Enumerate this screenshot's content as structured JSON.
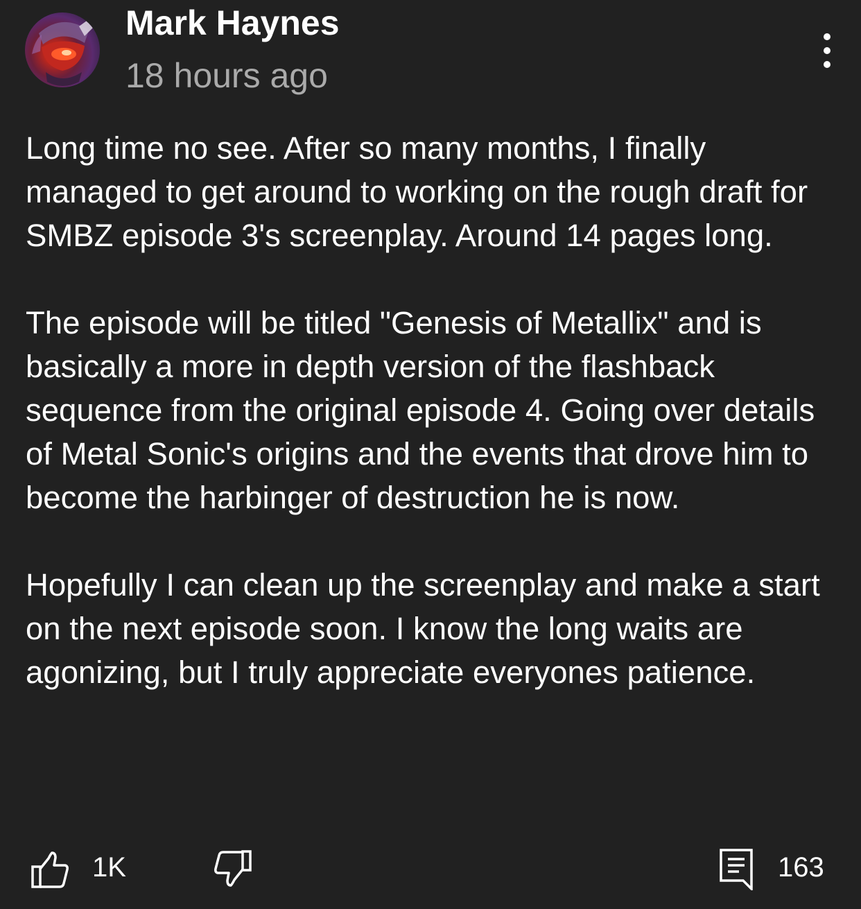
{
  "post": {
    "author": "Mark Haynes",
    "timestamp": "18 hours ago",
    "avatar_icon": "robot-helmet-avatar",
    "more_icon": "more-vertical-icon",
    "paragraphs": [
      "Long time no see. After so many months, I finally managed to get around to working on the rough draft for SMBZ episode 3's screenplay. Around 14 pages long.",
      "The episode will be titled \"Genesis of Metallix\" and is basically a more in depth version of the flashback sequence from the original episode 4. Going over details of Metal Sonic's origins and the events that drove him to become the harbinger of destruction he is now.",
      "Hopefully I can clean up the screenplay and make a start on the next episode soon. I know the long waits are agonizing, but I truly appreciate everyones patience."
    ]
  },
  "actions": {
    "like_icon": "thumbs-up-icon",
    "like_count": "1K",
    "dislike_icon": "thumbs-down-icon",
    "comment_icon": "comment-icon",
    "comment_count": "163"
  },
  "colors": {
    "background": "#212121",
    "text_primary": "#ffffff",
    "text_secondary": "#aaaaaa"
  }
}
